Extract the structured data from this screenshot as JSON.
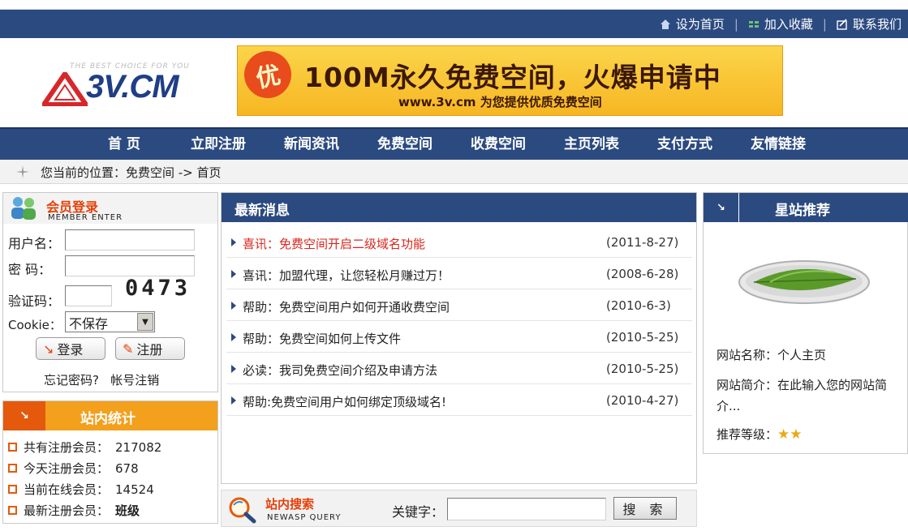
{
  "top_links": [
    {
      "label": "设为首页",
      "icon": "home-icon"
    },
    {
      "label": "加入收藏",
      "icon": "bookmark-icon"
    },
    {
      "label": "联系我们",
      "icon": "contact-icon"
    }
  ],
  "logo": {
    "tagline": "THE BEST CHOICE FOR YOU",
    "text": "3V.CM"
  },
  "banner": {
    "badge": "优",
    "headline": "100M永久免费空间，火爆申请中",
    "subline": "www.3v.cm 为您提供优质免费空间"
  },
  "nav": [
    "首 页",
    "立即注册",
    "新闻资讯",
    "免费空间",
    "收费空间",
    "主页列表",
    "支付方式",
    "友情链接"
  ],
  "breadcrumb": "您当前的位置：免费空间 -> 首页",
  "login": {
    "title": "会员登录",
    "subtitle": "MEMBER ENTER",
    "username_label": "用户名：",
    "password_label": "密  码：",
    "captcha_label": "验证码：",
    "captcha_value": "0473",
    "cookie_label": "Cookie：",
    "cookie_value": "不保存",
    "login_button": "登录",
    "register_button": "注册",
    "forgot_link": "忘记密码?",
    "cancel_link": "帐号注销"
  },
  "stats": {
    "title": "站内统计",
    "rows": [
      {
        "label": "共有注册会员：",
        "value": "217082"
      },
      {
        "label": "今天注册会员：",
        "value": "678"
      },
      {
        "label": "当前在线会员：",
        "value": "14524"
      },
      {
        "label": "最新注册会员：",
        "value": "班级"
      }
    ]
  },
  "news": {
    "title": "最新消息",
    "items": [
      {
        "title": "喜讯：免费空间开启二级域名功能",
        "date": "(2011-8-27)",
        "highlight": true
      },
      {
        "title": "喜讯：加盟代理，让您轻松月赚过万！",
        "date": "(2008-6-28)",
        "highlight": false
      },
      {
        "title": "帮助：免费空间用户如何开通收费空间",
        "date": "(2010-6-3)",
        "highlight": false
      },
      {
        "title": "帮助：免费空间如何上传文件",
        "date": "(2010-5-25)",
        "highlight": false
      },
      {
        "title": "必读：我司免费空间介绍及申请方法",
        "date": "(2010-5-25)",
        "highlight": false
      },
      {
        "title": "帮助:免费空间用户如何绑定顶级域名!",
        "date": "(2010-4-27)",
        "highlight": false
      }
    ]
  },
  "search": {
    "title": "站内搜索",
    "subtitle": "NEWASP QUERY",
    "keyword_label": "关键字：",
    "button": "搜 索"
  },
  "recommend": {
    "title": "星站推荐",
    "name_label": "网站名称：",
    "name_value": "个人主页",
    "desc_label": "网站简介：",
    "desc_value": "在此输入您的网站简介...",
    "level_label": "推荐等级：",
    "stars": 2
  },
  "colors": {
    "nav_blue": "#2b4a80",
    "accent_red": "#e6400a",
    "accent_orange": "#f3a01d"
  }
}
